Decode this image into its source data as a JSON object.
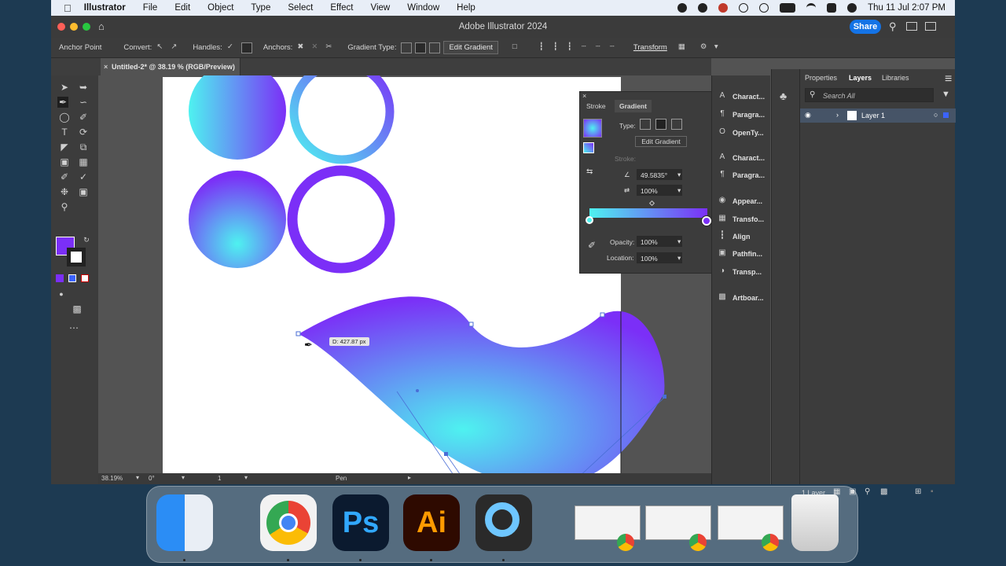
{
  "menubar": {
    "app": "Illustrator",
    "items": [
      "File",
      "Edit",
      "Object",
      "Type",
      "Select",
      "Effect",
      "View",
      "Window",
      "Help"
    ],
    "clock": "Thu 11 Jul  2:07 PM"
  },
  "window": {
    "title": "Adobe Illustrator 2024",
    "share_label": "Share"
  },
  "control_bar": {
    "tool_name": "Anchor Point",
    "convert_label": "Convert:",
    "handles_label": "Handles:",
    "anchors_label": "Anchors:",
    "gradient_type_label": "Gradient Type:",
    "edit_gradient_label": "Edit Gradient",
    "transform_label": "Transform"
  },
  "document": {
    "tab_title": "Untitled-2* @ 38.19 % (RGB/Preview)",
    "measure_tooltip": "D: 427.87 px"
  },
  "status_bar": {
    "zoom": "38.19%",
    "rotation": "0°",
    "artboard": "1",
    "tool": "Pen"
  },
  "gradient_panel": {
    "tabs": [
      "Stroke",
      "Gradient"
    ],
    "type_label": "Type:",
    "edit_gradient_label": "Edit Gradient",
    "stroke_label": "Stroke:",
    "angle_value": "49.5835°",
    "aspect_value": "100%",
    "opacity_label": "Opacity:",
    "opacity_value": "100%",
    "location_label": "Location:",
    "location_value": "100%",
    "colors": {
      "start": "#4ef2f0",
      "end": "#7b2ff7"
    }
  },
  "collapsed_panels": [
    "Charact...",
    "Paragra...",
    "OpenTy...",
    "Charact...",
    "Paragra...",
    "Appear...",
    "Transfo...",
    "Align",
    "Pathfin...",
    "Transp...",
    "Artboar..."
  ],
  "right_panel": {
    "tabs": [
      "Properties",
      "Layers",
      "Libraries"
    ],
    "search_placeholder": "Search All",
    "layer_name": "Layer 1",
    "footer": "1 Layer"
  },
  "dock": {
    "apps": [
      "finder-icon",
      "chrome-icon",
      "photoshop-icon",
      "illustrator-icon",
      "quicktime-icon",
      "trash-icon"
    ],
    "ps_label": "Ps",
    "ai_label": "Ai"
  },
  "colors": {
    "accent": "#1473e6",
    "cyan": "#4ef2f0",
    "purple": "#7b2ff7"
  }
}
